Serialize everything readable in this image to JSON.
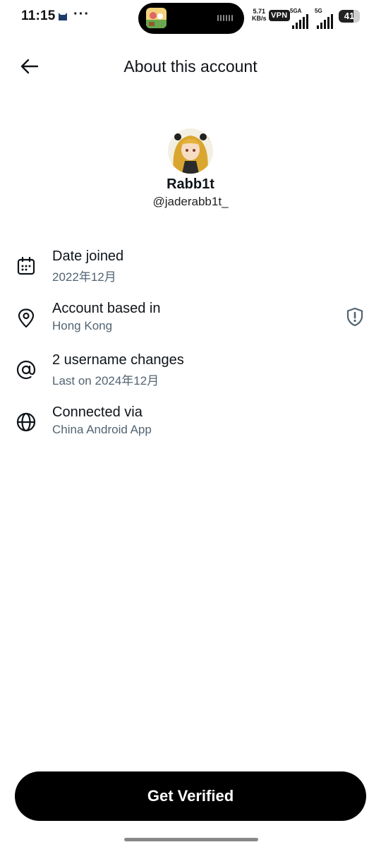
{
  "status_bar": {
    "time": "11:15",
    "net_speed_value": "5.71",
    "net_speed_unit": "KB/s",
    "vpn": "VPN",
    "sim1_label": "5GA",
    "sim2_label": "5G",
    "battery": "41"
  },
  "header": {
    "title": "About this account",
    "back_icon": "arrow-left-icon"
  },
  "profile": {
    "display_name": "Rabb1t",
    "handle": "@jaderabb1t_"
  },
  "rows": [
    {
      "icon": "calendar-icon",
      "title": "Date joined",
      "subtitle": "2022年12月"
    },
    {
      "icon": "location-pin-icon",
      "title": "Account based in",
      "subtitle": "Hong Kong",
      "badge_icon": "shield-alert-icon"
    },
    {
      "icon": "at-sign-icon",
      "title": "2 username changes",
      "subtitle": "Last on 2024年12月"
    },
    {
      "icon": "globe-icon",
      "title": "Connected via",
      "subtitle": "China Android App"
    }
  ],
  "cta": {
    "label": "Get Verified"
  },
  "colors": {
    "text_primary": "#0f1419",
    "text_secondary": "#536471",
    "button_bg": "#000000",
    "button_text": "#ffffff"
  }
}
